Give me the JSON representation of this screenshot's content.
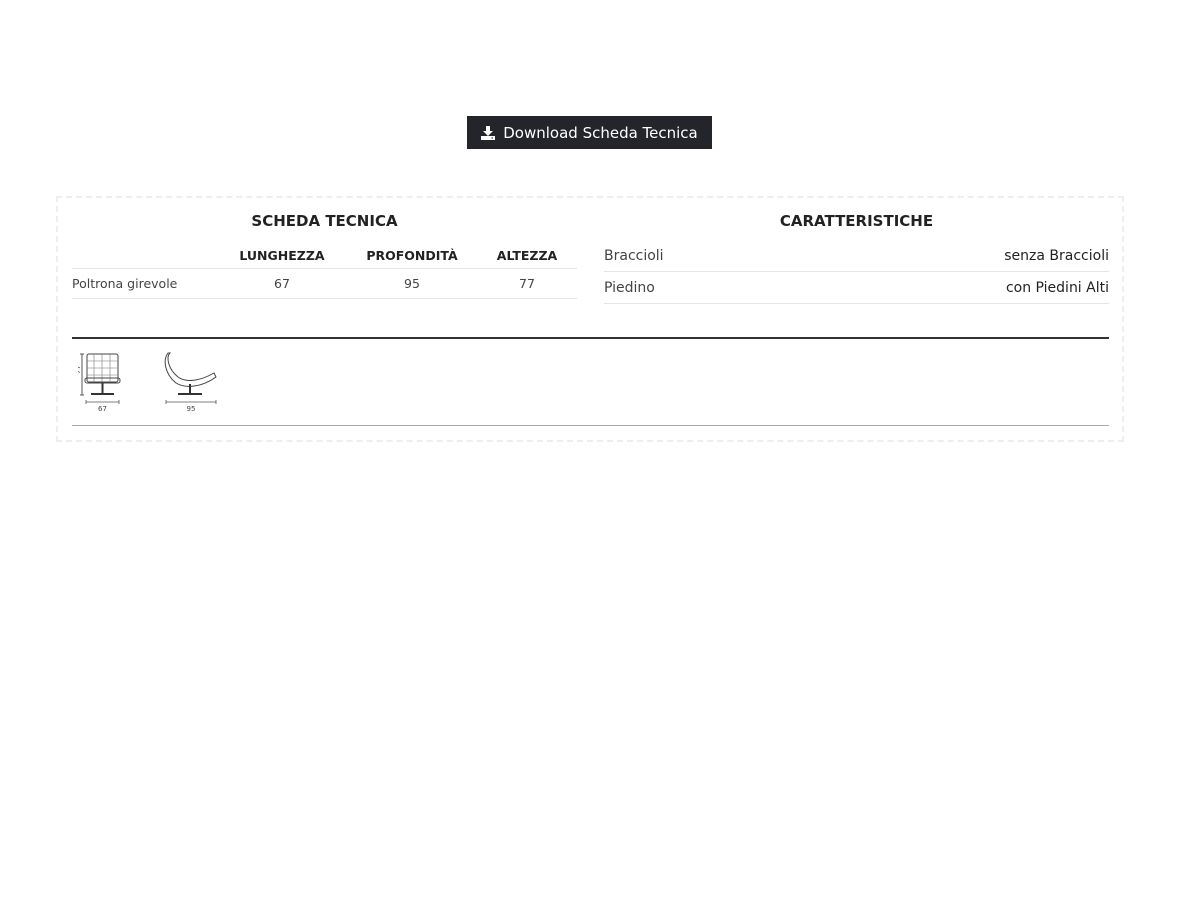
{
  "download": {
    "label": "Download Scheda Tecnica",
    "icon": "download-icon",
    "background": "#23252a"
  },
  "scheda_tecnica": {
    "title": "SCHEDA TECNICA",
    "columns": [
      "LUNGHEZZA",
      "PROFONDITÀ",
      "ALTEZZA"
    ],
    "rows": [
      {
        "label": "Poltrona girevole",
        "values": [
          "67",
          "95",
          "77"
        ]
      }
    ]
  },
  "caratteristiche": {
    "title": "CARATTERISTICHE",
    "items": [
      {
        "label": "Braccioli",
        "value": "senza Braccioli"
      },
      {
        "label": "Piedino",
        "value": "con Piedini Alti"
      }
    ]
  },
  "drawings": {
    "front": {
      "height_label": "77",
      "width_label": "67"
    },
    "side": {
      "depth_label": "95"
    }
  }
}
